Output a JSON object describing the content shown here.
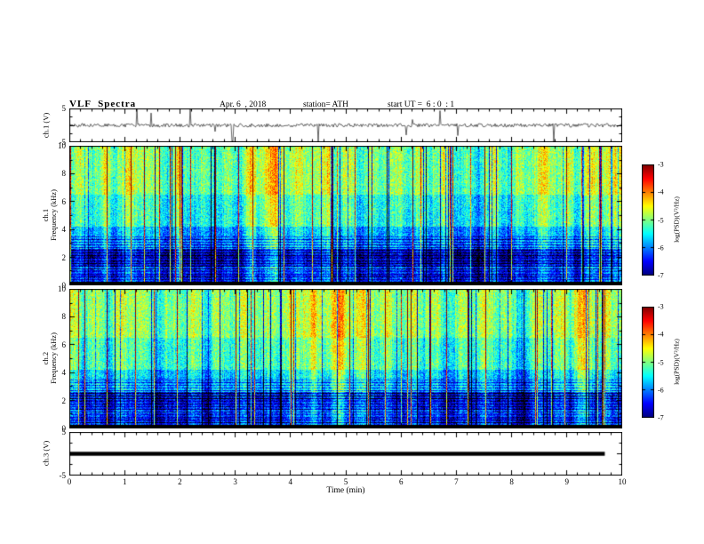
{
  "header": {
    "title": "VLF  Spectra",
    "date": "Apr. 6  , 2018",
    "station": "station= ATH",
    "start_ut": "start UT =  6 : 0  : 1"
  },
  "x_axis": {
    "label": "Time (min)",
    "ticks": [
      "0",
      "1",
      "2",
      "3",
      "4",
      "5",
      "6",
      "7",
      "8",
      "9",
      "10"
    ],
    "range": [
      0,
      10
    ]
  },
  "left_labels": {
    "wave": "ch.1 (V)",
    "spec1_ch": "ch.1",
    "spec2_ch": "ch.2",
    "freq": "Frequency (kHz)",
    "ch3": "ch.3 (V)"
  },
  "volt_ticks": [
    "5",
    "-5"
  ],
  "spec_yticks": [
    "10",
    "8",
    "6",
    "4",
    "2",
    "0"
  ],
  "colorbar": {
    "label": "log(PSD)(V²/Hz)",
    "ticks": [
      "-3",
      "-4",
      "-5",
      "-6",
      "-7"
    ],
    "min": -7,
    "max": -3,
    "colormap": "jet"
  },
  "colors": {
    "background": "#ffffff",
    "frame": "#000000",
    "trace": "#000000"
  },
  "chart_data": [
    {
      "type": "line",
      "name": "ch1_waveform",
      "ylabel": "ch.1 (V)",
      "xlim": [
        0,
        10
      ],
      "ylim": [
        -5,
        5
      ],
      "yticks": [
        5,
        -5
      ],
      "description": "continuous broadband noise of about ±1 V with frequent impulsive spikes reaching ±5 V across the full 10 min record",
      "seed": 777
    },
    {
      "type": "heatmap",
      "name": "ch1_spectrogram",
      "ylabel": "ch.1 Frequency (kHz)",
      "xlim": [
        0,
        10
      ],
      "ylim": [
        0,
        10
      ],
      "yticks": [
        10,
        8,
        6,
        4,
        2,
        0
      ],
      "colorbar": {
        "label": "log(PSD)(V²/Hz)",
        "ticks": [
          -3,
          -4,
          -5,
          -6,
          -7
        ],
        "min": -7,
        "max": -3
      },
      "band_profile": [
        {
          "freq_khz": [
            0,
            0.25
          ],
          "psd": -7.5
        },
        {
          "freq_khz": [
            0.25,
            0.9
          ],
          "psd": -6.1
        },
        {
          "freq_khz": [
            0.9,
            1.4
          ],
          "psd": -5.9
        },
        {
          "freq_khz": [
            1.4,
            2.6
          ],
          "psd": -6.3
        },
        {
          "freq_khz": [
            2.6,
            4.2
          ],
          "psd": -5.6
        },
        {
          "freq_khz": [
            4.2,
            6.5
          ],
          "psd": -5.15
        },
        {
          "freq_khz": [
            6.5,
            10.01
          ],
          "psd": -4.8
        }
      ],
      "features": [
        "dense vertical sferic stripes reaching -3 (red/yellow)",
        "dark vertical dropout stripes",
        "horizontal hum lines below ~3.5 kHz",
        "black band near 0 kHz"
      ],
      "seed": 1337
    },
    {
      "type": "heatmap",
      "name": "ch2_spectrogram",
      "ylabel": "ch.2 Frequency (kHz)",
      "xlim": [
        0,
        10
      ],
      "ylim": [
        0,
        10
      ],
      "yticks": [
        10,
        8,
        6,
        4,
        2,
        0
      ],
      "colorbar": {
        "label": "log(PSD)(V²/Hz)",
        "ticks": [
          -3,
          -4,
          -5,
          -6,
          -7
        ],
        "min": -7,
        "max": -3
      },
      "band_profile": [
        {
          "freq_khz": [
            0,
            0.25
          ],
          "psd": -7.5
        },
        {
          "freq_khz": [
            0.25,
            0.9
          ],
          "psd": -6.1
        },
        {
          "freq_khz": [
            0.9,
            1.4
          ],
          "psd": -5.9
        },
        {
          "freq_khz": [
            1.4,
            2.6
          ],
          "psd": -6.2
        },
        {
          "freq_khz": [
            2.6,
            4.2
          ],
          "psd": -5.5
        },
        {
          "freq_khz": [
            4.2,
            6.5
          ],
          "psd": -5.1
        },
        {
          "freq_khz": [
            6.5,
            10.01
          ],
          "psd": -4.8
        }
      ],
      "features": [
        "dense vertical sferic stripes reaching -3 (red/yellow)",
        "dark vertical dropout stripes",
        "horizontal hum lines below ~3.5 kHz",
        "black band near 0 kHz"
      ],
      "seed": 4242
    },
    {
      "type": "line",
      "name": "ch3_waveform",
      "ylabel": "ch.3 (V)",
      "xlim": [
        0,
        10
      ],
      "ylim": [
        -5,
        5
      ],
      "yticks": [
        5,
        -5
      ],
      "value": 0,
      "x_extent": [
        0,
        9.7
      ],
      "description": "flat heavy line at 0 V from 0 to ~9.7 min (no signal)"
    }
  ]
}
